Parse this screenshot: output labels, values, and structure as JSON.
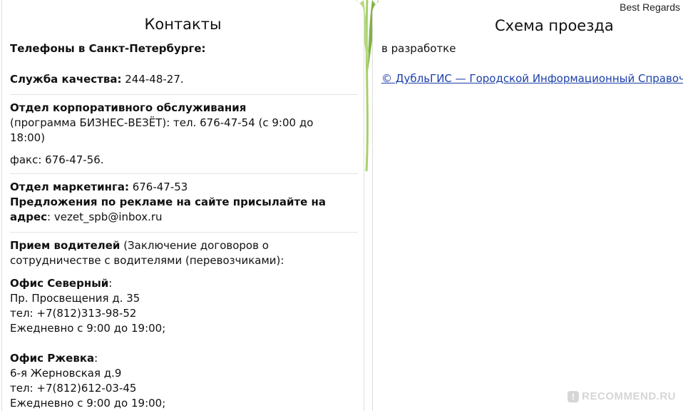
{
  "header": {
    "best_regards": "Best Regards"
  },
  "contacts": {
    "title": "Контакты",
    "phones_heading": "Телефоны в Санкт-Петербурге:",
    "quality": {
      "label": "Служба качества:",
      "phone": " 244-48-27."
    },
    "corporate": {
      "label": "Отдел корпоративного обслуживания",
      "line1": "(программа БИЗНЕС-ВЕЗЁТ): тел.   676-47-54  (с 9:00 до",
      "line2": "18:00)",
      "fax": "факс: 676-47-56."
    },
    "marketing": {
      "label": "Отдел маркетинга:",
      "phone": " 676-47-53",
      "ads_line1": "Предложения по рекламе на сайте присылайте на",
      "ads_label2": "адрес",
      "email": ":  vezet_spb@inbox.ru"
    },
    "drivers": {
      "label": "Прием водителей",
      "line1_rest": " (Заключение договоров о",
      "line2": "сотрудничестве с водителями (перевозчиками):"
    },
    "office_north": {
      "label": "Офис Северный",
      "colon": ":",
      "address": "Пр. Просвещения д. 35",
      "phone": "тел: +7(812)313-98-52",
      "hours": "Ежедневно с 9:00 до 19:00;"
    },
    "office_rzhevka": {
      "label": "Офис Ржевка",
      "colon": ":",
      "address": "6-я Жерновская д.9",
      "phone": "тел: +7(812)612-03-45",
      "hours": "Ежедневно с 9:00 до 19:00;"
    }
  },
  "route": {
    "title": "Схема проезда",
    "status": "в разработке",
    "link_text": "© ДубльГИС — Городской Информационный Справочник"
  },
  "watermark": {
    "icon_glyph": "!",
    "text": "RECOMMEND.RU"
  },
  "colors": {
    "link": "#1a3fa8",
    "divider": "#e3e3e3",
    "plant": "#8fc24a"
  }
}
